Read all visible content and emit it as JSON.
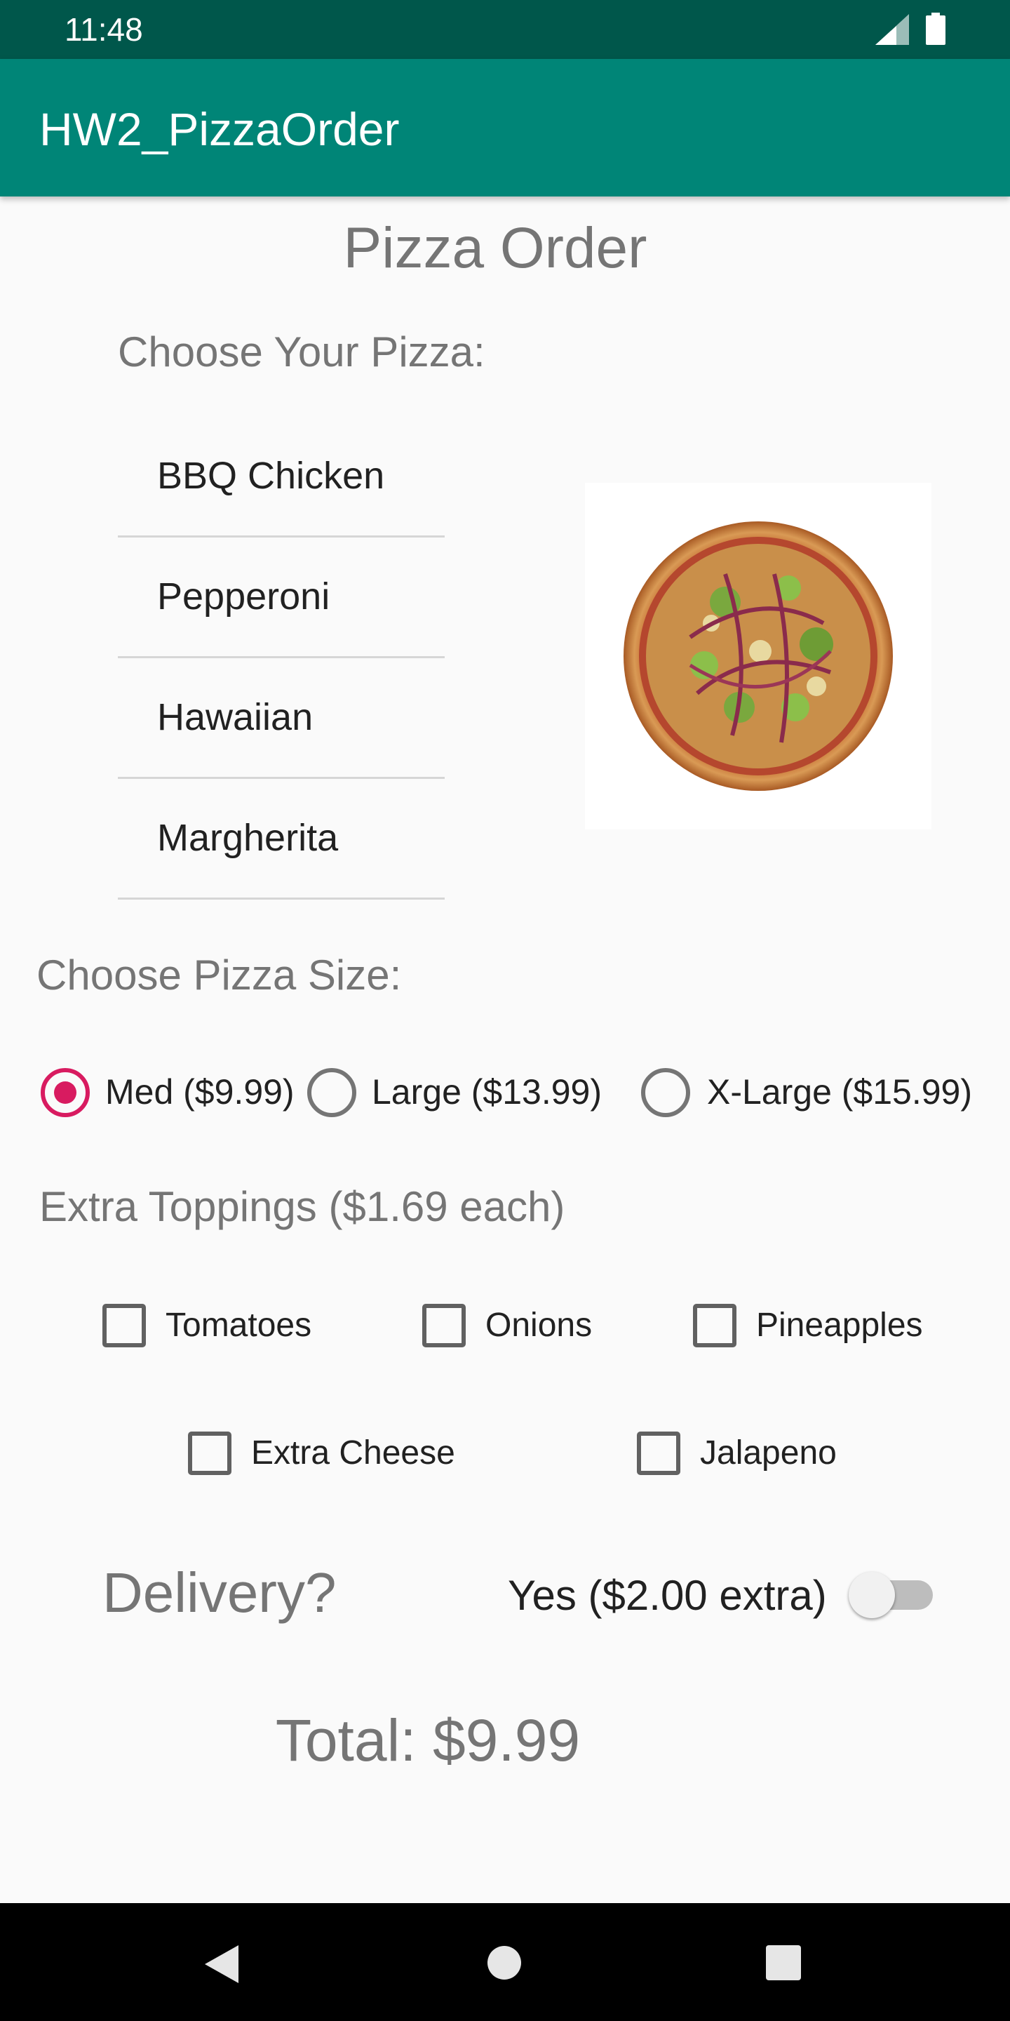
{
  "status_bar": {
    "time": "11:48"
  },
  "app_bar": {
    "title": "HW2_PizzaOrder"
  },
  "page_title": "Pizza Order",
  "pizza_section": {
    "label": "Choose Your Pizza:",
    "items": [
      "BBQ Chicken",
      "Pepperoni",
      "Hawaiian",
      "Margherita"
    ]
  },
  "size_section": {
    "label": "Choose Pizza Size:",
    "options": [
      {
        "label": "Med ($9.99)",
        "checked": true
      },
      {
        "label": "Large ($13.99)",
        "checked": false
      },
      {
        "label": "X-Large ($15.99)",
        "checked": false
      }
    ]
  },
  "toppings_section": {
    "label": "Extra Toppings ($1.69 each)",
    "options": [
      {
        "label": "Tomatoes",
        "checked": false
      },
      {
        "label": "Onions",
        "checked": false
      },
      {
        "label": "Pineapples",
        "checked": false
      },
      {
        "label": "Extra Cheese",
        "checked": false
      },
      {
        "label": "Jalapeno",
        "checked": false
      }
    ]
  },
  "delivery": {
    "label": "Delivery?",
    "option": "Yes ($2.00 extra)",
    "enabled": false
  },
  "total": "Total: $9.99",
  "colors": {
    "status_bar": "#00574b",
    "app_bar": "#008577",
    "accent": "#d81b60"
  },
  "icons": {
    "status": [
      "signal-icon",
      "battery-icon"
    ],
    "nav": [
      "back-icon",
      "home-icon",
      "recents-icon"
    ]
  }
}
